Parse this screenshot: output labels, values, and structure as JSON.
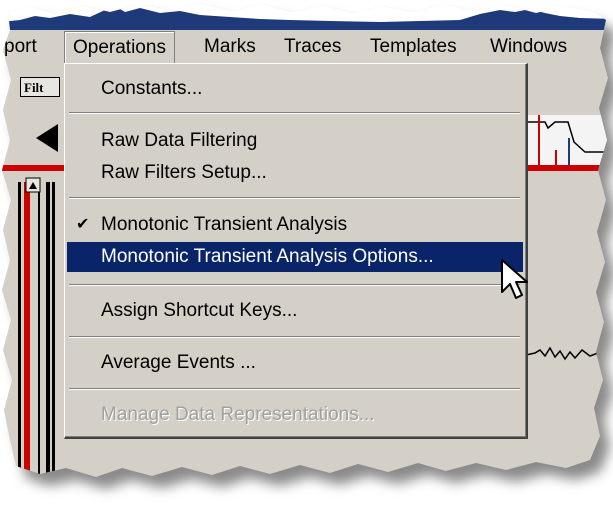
{
  "menubar": {
    "items": [
      {
        "label": "port"
      },
      {
        "label": "Operations"
      },
      {
        "label": "Marks"
      },
      {
        "label": "Traces"
      },
      {
        "label": "Templates"
      },
      {
        "label": "Windows"
      }
    ]
  },
  "toolbar": {
    "filter_button": "Filt"
  },
  "dropdown": {
    "items": [
      {
        "label": "Constants...",
        "checked": false,
        "enabled": true
      },
      {
        "label": "Raw Data Filtering",
        "checked": false,
        "enabled": true
      },
      {
        "label": "Raw Filters Setup...",
        "checked": false,
        "enabled": true
      },
      {
        "label": "Monotonic Transient Analysis",
        "checked": true,
        "enabled": true
      },
      {
        "label": "Monotonic Transient Analysis Options...",
        "checked": false,
        "enabled": true,
        "highlighted": true
      },
      {
        "label": "Assign Shortcut Keys...",
        "checked": false,
        "enabled": true
      },
      {
        "label": "Average Events ...",
        "checked": false,
        "enabled": true
      },
      {
        "label": "Manage Data Representations...",
        "checked": false,
        "enabled": false
      }
    ],
    "check_glyph": "✔"
  },
  "colors": {
    "menu_bg": "#d4d0c8",
    "highlight": "#0a246a",
    "disabled_text": "#a0a0a0",
    "waveform": "#1f3a7a",
    "trace_red": "#cc0000"
  }
}
